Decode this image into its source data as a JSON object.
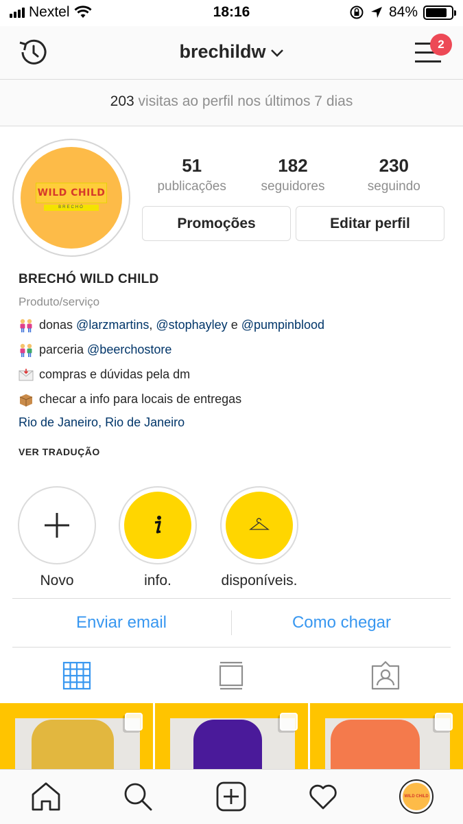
{
  "status_bar": {
    "carrier": "Nextel",
    "time": "18:16",
    "battery": "84%",
    "battery_level": 0.84
  },
  "nav": {
    "username": "brechildw",
    "notification_count": "2",
    "history_icon": "history-icon",
    "menu_icon": "menu-icon"
  },
  "visits": {
    "count": "203",
    "text": "visitas ao perfil nos últimos 7 dias"
  },
  "profile": {
    "avatar_logo_text": "WILD CHILD",
    "avatar_logo_subtext": "BRECHÓ",
    "stats": [
      {
        "value": "51",
        "label": "publicações"
      },
      {
        "value": "182",
        "label": "seguidores"
      },
      {
        "value": "230",
        "label": "seguindo"
      }
    ],
    "buttons": {
      "promotions": "Promoções",
      "edit_profile": "Editar perfil"
    }
  },
  "bio": {
    "name": "BRECHÓ WILD CHILD",
    "category": "Produto/serviço",
    "line1": {
      "emoji": "two-women-icon",
      "prefix": "donas ",
      "mention1": "@larzmartins",
      "sep1": ", ",
      "mention2": "@stophayley",
      "sep2": " e ",
      "mention3": "@pumpinblood"
    },
    "line2": {
      "emoji": "couple-icon",
      "prefix": "parceria ",
      "mention": "@beerchostore"
    },
    "line3": {
      "emoji": "envelope-icon",
      "text": "compras e dúvidas pela dm"
    },
    "line4": {
      "emoji": "package-icon",
      "text": "checar a info para locais de entregas"
    },
    "location": "Rio de Janeiro, Rio de Janeiro",
    "translate": "VER TRADUÇÃO"
  },
  "highlights": [
    {
      "label": "Novo",
      "icon": "plus-icon"
    },
    {
      "label": "info.",
      "icon": "info-icon"
    },
    {
      "label": "disponíveis.",
      "icon": "hanger-icon"
    }
  ],
  "contact": {
    "email": "Enviar email",
    "directions": "Como chegar"
  },
  "tabs": [
    "grid-icon",
    "feed-icon",
    "tagged-icon"
  ],
  "colors": {
    "accent_blue": "#3897f0",
    "mention_blue": "#003569",
    "badge_red": "#ed4956",
    "highlight_yellow": "#ffd600",
    "avatar_orange": "#fdbb48",
    "post_yellow": "#ffc400"
  },
  "bottom_nav": [
    "home-icon",
    "search-icon",
    "add-post-icon",
    "heart-icon",
    "profile-avatar"
  ]
}
